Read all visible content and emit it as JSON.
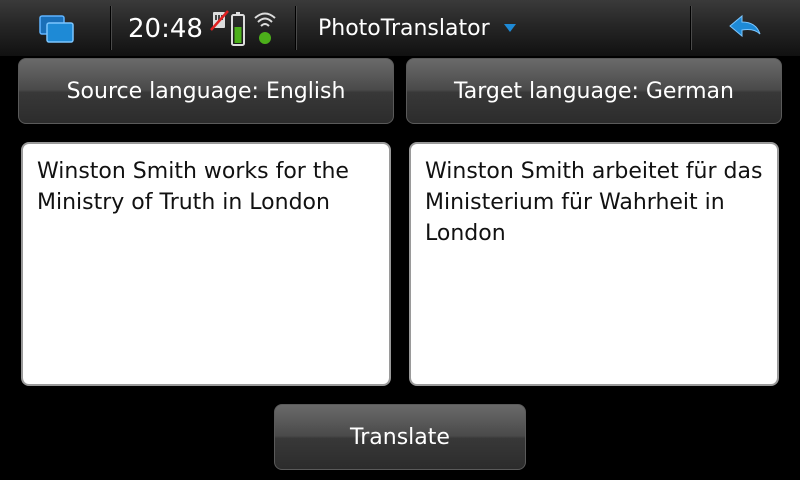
{
  "statusbar": {
    "clock": "20:48",
    "icons": [
      "task-switcher-icon",
      "sim-blocked-icon",
      "battery-icon",
      "wifi-icon",
      "back-arrow-icon"
    ]
  },
  "app": {
    "title": "PhotoTranslator"
  },
  "source_language_button": "Source language: English",
  "target_language_button": "Target language: German",
  "source_text": "Winston Smith works for the Ministry of Truth in London",
  "target_text": "Winston Smith arbeitet für das Ministerium für Wahrheit in London",
  "translate_button": "Translate",
  "colors": {
    "background": "#000000",
    "accent": "#1e8ad6",
    "battery_level": "#4caf1a",
    "text_area_bg": "#ffffff"
  }
}
